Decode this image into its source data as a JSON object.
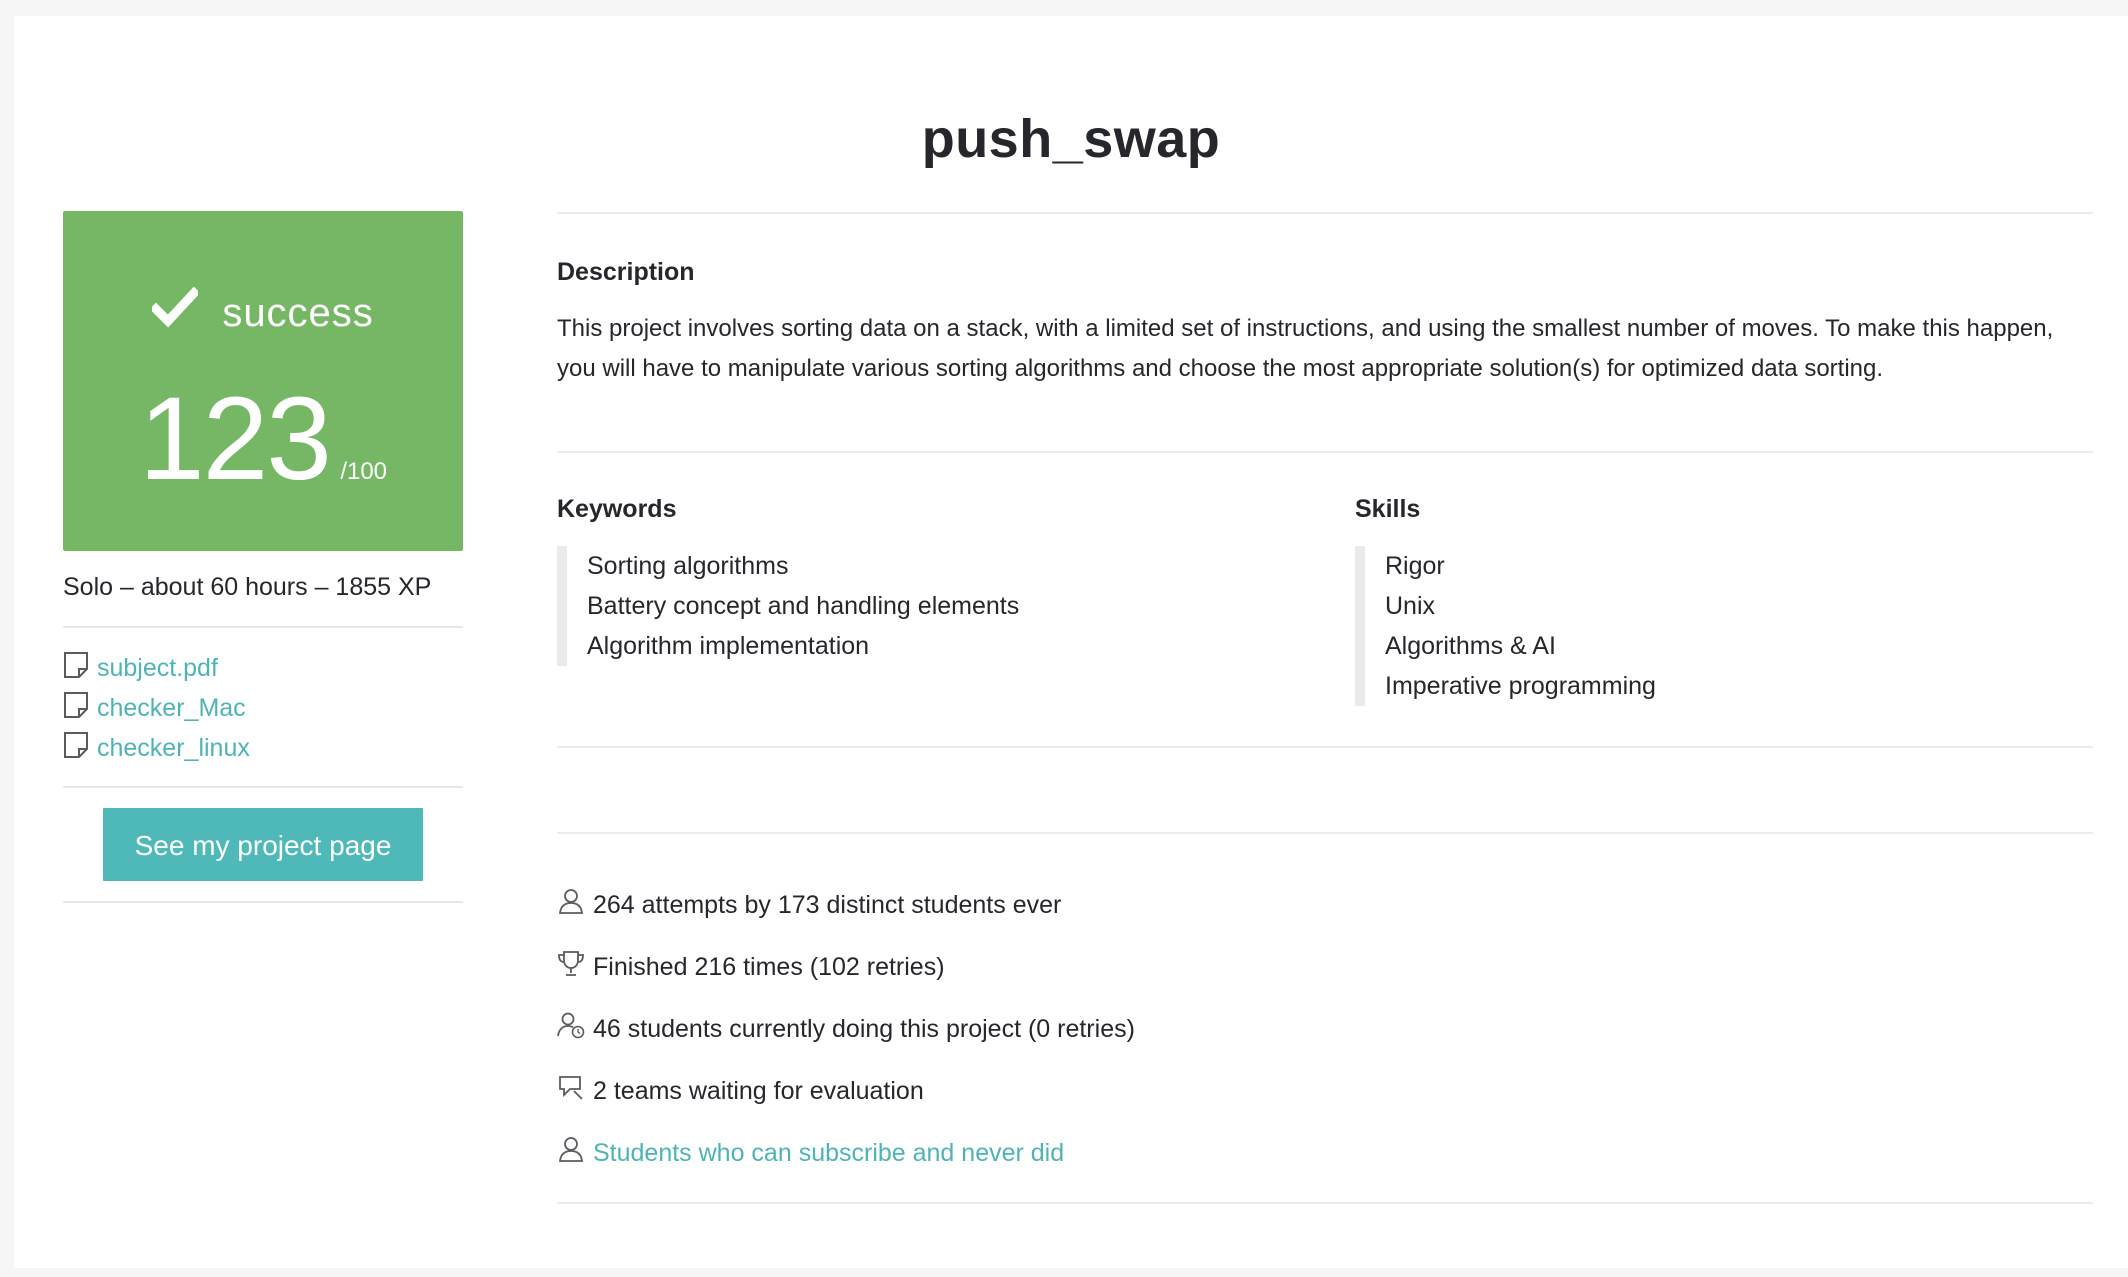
{
  "project": {
    "title": "push_swap"
  },
  "score": {
    "status": "success",
    "value": "123",
    "max": "/100",
    "color": "#76b765"
  },
  "info": {
    "line": "Solo – about 60 hours – 1855 XP"
  },
  "files": [
    {
      "name": "subject.pdf",
      "icon": "document-icon"
    },
    {
      "name": "checker_Mac",
      "icon": "document-icon"
    },
    {
      "name": "checker_linux",
      "icon": "document-icon"
    }
  ],
  "button": {
    "label": "See my project page",
    "color": "#4fb8b8"
  },
  "description": {
    "title": "Description",
    "text": "This project involves sorting data on a stack, with a limited set of instructions, and using the smallest number of moves. To make this happen, you will have to manipulate various sorting algorithms and choose the most appropriate solution(s) for optimized data sorting."
  },
  "keywords": {
    "title": "Keywords",
    "items": [
      "Sorting algorithms",
      "Battery concept and handling elements",
      "Algorithm implementation"
    ]
  },
  "skills": {
    "title": "Skills",
    "items": [
      "Rigor",
      "Unix",
      "Algorithms & AI",
      "Imperative programming"
    ]
  },
  "stats": {
    "attempts": "264 attempts by 173 distinct students ever",
    "finished": "Finished 216 times (102 retries)",
    "current": "46 students currently doing this project (0 retries)",
    "waiting": "2 teams waiting for evaluation",
    "subscribe_link": "Students who can subscribe and never did"
  },
  "colors": {
    "accent": "#4fb3b5",
    "text": "#26272c",
    "success": "#76b765"
  }
}
